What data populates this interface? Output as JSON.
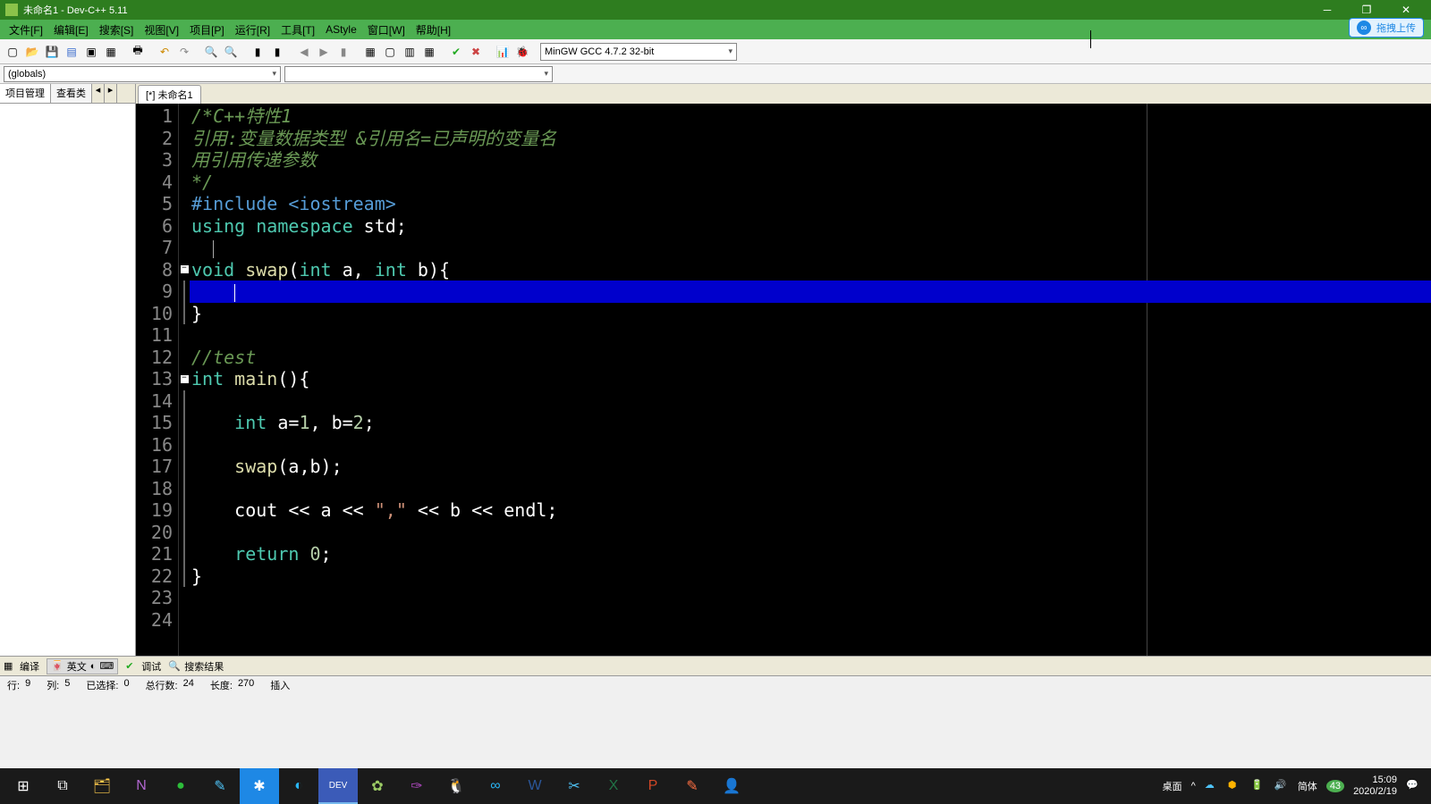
{
  "window": {
    "title": "未命名1 - Dev-C++ 5.11"
  },
  "menu": {
    "file": "文件[F]",
    "edit": "编辑[E]",
    "search": "搜索[S]",
    "view": "视图[V]",
    "project": "项目[P]",
    "run": "运行[R]",
    "tools": "工具[T]",
    "astyle": "AStyle",
    "window": "窗口[W]",
    "help": "帮助[H]"
  },
  "cloud": {
    "label": "拖拽上传"
  },
  "toolbar": {
    "compiler": "MinGW GCC 4.7.2 32-bit"
  },
  "scope": {
    "globals": "(globals)"
  },
  "left_tabs": {
    "project": "项目管理",
    "classes": "查看类"
  },
  "editor_tab": "[*] 未命名1",
  "code_lines": [
    {
      "n": 1,
      "segs": [
        {
          "c": "cm",
          "t": "/*C++特性1"
        }
      ]
    },
    {
      "n": 2,
      "segs": [
        {
          "c": "cm",
          "t": "引用:变量数据类型 &引用名=已声明的变量名"
        }
      ]
    },
    {
      "n": 3,
      "segs": [
        {
          "c": "cm",
          "t": "用引用传递参数"
        }
      ]
    },
    {
      "n": 4,
      "segs": [
        {
          "c": "cm",
          "t": "*/"
        }
      ]
    },
    {
      "n": 5,
      "segs": [
        {
          "c": "pp",
          "t": "#include <iostream>"
        }
      ]
    },
    {
      "n": 6,
      "segs": [
        {
          "c": "kw",
          "t": "using "
        },
        {
          "c": "kw",
          "t": "namespace "
        },
        {
          "c": "id",
          "t": "std"
        },
        {
          "c": "op",
          "t": ";"
        }
      ]
    },
    {
      "n": 7,
      "segs": [
        {
          "c": "id",
          "t": "  "
        }
      ],
      "textcaret": true
    },
    {
      "n": 8,
      "fold": "box",
      "segs": [
        {
          "c": "kw",
          "t": "void "
        },
        {
          "c": "fn",
          "t": "swap"
        },
        {
          "c": "op",
          "t": "("
        },
        {
          "c": "ty",
          "t": "int "
        },
        {
          "c": "id",
          "t": "a"
        },
        {
          "c": "op",
          "t": ", "
        },
        {
          "c": "ty",
          "t": "int "
        },
        {
          "c": "id",
          "t": "b"
        },
        {
          "c": "op",
          "t": "){"
        }
      ]
    },
    {
      "n": 9,
      "fold": "line",
      "hl": true,
      "segs": [
        {
          "c": "id",
          "t": "    "
        }
      ],
      "caret": true
    },
    {
      "n": 10,
      "fold": "end",
      "segs": [
        {
          "c": "op",
          "t": "}"
        }
      ]
    },
    {
      "n": 11,
      "segs": []
    },
    {
      "n": 12,
      "segs": [
        {
          "c": "cmline",
          "t": "//test"
        }
      ]
    },
    {
      "n": 13,
      "fold": "box",
      "segs": [
        {
          "c": "ty",
          "t": "int "
        },
        {
          "c": "fn",
          "t": "main"
        },
        {
          "c": "op",
          "t": "(){"
        }
      ]
    },
    {
      "n": 14,
      "fold": "line",
      "segs": []
    },
    {
      "n": 15,
      "fold": "line",
      "segs": [
        {
          "c": "id",
          "t": "    "
        },
        {
          "c": "ty",
          "t": "int "
        },
        {
          "c": "id",
          "t": "a"
        },
        {
          "c": "op",
          "t": "="
        },
        {
          "c": "num",
          "t": "1"
        },
        {
          "c": "op",
          "t": ", "
        },
        {
          "c": "id",
          "t": "b"
        },
        {
          "c": "op",
          "t": "="
        },
        {
          "c": "num",
          "t": "2"
        },
        {
          "c": "op",
          "t": ";"
        }
      ]
    },
    {
      "n": 16,
      "fold": "line",
      "segs": []
    },
    {
      "n": 17,
      "fold": "line",
      "segs": [
        {
          "c": "id",
          "t": "    "
        },
        {
          "c": "fn",
          "t": "swap"
        },
        {
          "c": "op",
          "t": "("
        },
        {
          "c": "id",
          "t": "a"
        },
        {
          "c": "op",
          "t": ","
        },
        {
          "c": "id",
          "t": "b"
        },
        {
          "c": "op",
          "t": ");"
        }
      ]
    },
    {
      "n": 18,
      "fold": "line",
      "segs": []
    },
    {
      "n": 19,
      "fold": "line",
      "segs": [
        {
          "c": "id",
          "t": "    "
        },
        {
          "c": "id",
          "t": "cout "
        },
        {
          "c": "op",
          "t": "<< "
        },
        {
          "c": "id",
          "t": "a "
        },
        {
          "c": "op",
          "t": "<< "
        },
        {
          "c": "str",
          "t": "\",\" "
        },
        {
          "c": "op",
          "t": "<< "
        },
        {
          "c": "id",
          "t": "b "
        },
        {
          "c": "op",
          "t": "<< "
        },
        {
          "c": "id",
          "t": "endl"
        },
        {
          "c": "op",
          "t": ";"
        }
      ]
    },
    {
      "n": 20,
      "fold": "line",
      "segs": []
    },
    {
      "n": 21,
      "fold": "line",
      "segs": [
        {
          "c": "id",
          "t": "    "
        },
        {
          "c": "kw",
          "t": "return "
        },
        {
          "c": "num",
          "t": "0"
        },
        {
          "c": "op",
          "t": ";"
        }
      ]
    },
    {
      "n": 22,
      "fold": "end",
      "segs": [
        {
          "c": "op",
          "t": "}"
        }
      ]
    },
    {
      "n": 23,
      "segs": []
    },
    {
      "n": 24,
      "segs": []
    }
  ],
  "bottom_tabs": {
    "compile": "编译",
    "ime": "英文",
    "debug": "调试",
    "search": "搜索结果"
  },
  "status": {
    "row_label": "行:",
    "row": "9",
    "col_label": "列:",
    "col": "5",
    "sel_label": "已选择:",
    "sel": "0",
    "total_label": "总行数:",
    "total": "24",
    "len_label": "长度:",
    "len": "270",
    "mode": "插入"
  },
  "tray": {
    "desktop": "桌面",
    "lang": "简体",
    "time": "15:09",
    "date": "2020/2/19",
    "badge": "43"
  }
}
